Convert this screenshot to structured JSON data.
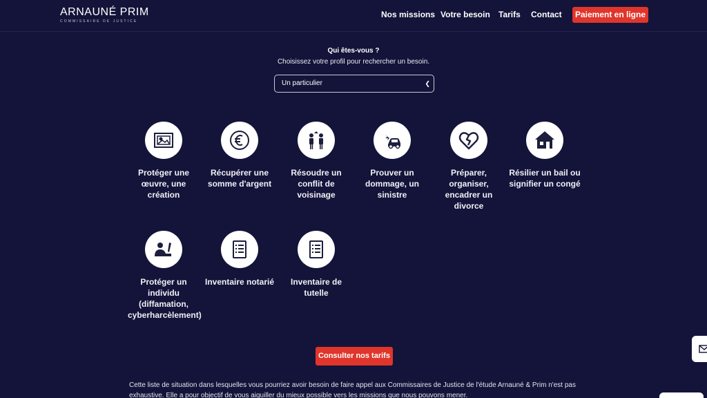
{
  "brand": {
    "name": "ARNAUNÉ PRIM",
    "tagline": "COMMISSAIRE DE JUSTICE"
  },
  "nav": {
    "items": [
      "Nos missions",
      "Votre besoin",
      "Tarifs",
      "Contact"
    ],
    "cta": "Paiement en ligne"
  },
  "profile": {
    "title": "Qui êtes-vous ?",
    "subtitle": "Choisissez votre profil pour rechercher un besoin.",
    "selected": "Un particulier"
  },
  "needs": [
    {
      "icon": "frame-icon",
      "label": "Protéger une œuvre, une création"
    },
    {
      "icon": "euro-icon",
      "label": "Récupérer une somme d'argent"
    },
    {
      "icon": "neighbors-icon",
      "label": "Résoudre un conflit de voisinage"
    },
    {
      "icon": "car-crash-icon",
      "label": "Prouver un dommage, un sinistre"
    },
    {
      "icon": "broken-heart-icon",
      "label": "Préparer, organiser, encadrer un divorce"
    },
    {
      "icon": "house-icon",
      "label": "Résilier un bail ou signifier un congé"
    },
    {
      "icon": "person-writing-icon",
      "label": "Protéger un individu (diffamation, cyberharcèlement)"
    },
    {
      "icon": "document-list-icon",
      "label": "Inventaire notarié"
    },
    {
      "icon": "document-list-icon",
      "label": "Inventaire de tutelle"
    }
  ],
  "cta": {
    "label": "Consulter nos tarifs"
  },
  "intro": "Cette liste de situation dans lesquelles vous pourriez avoir besoin de faire appel aux Commissaires de Justice de l'étude Arnauné & Prim n'est pas exhaustive. Elle a pour objectif de vous aiguiller du mieux possible vers les missions que nous pouvons mener.",
  "colors": {
    "background": "#14143a",
    "accent": "#e0352b",
    "icon": "#1d1d3d"
  }
}
